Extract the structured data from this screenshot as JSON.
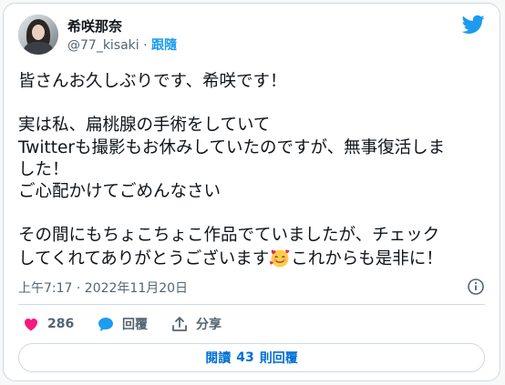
{
  "author": {
    "display_name": "希咲那奈",
    "handle": "@77_kisaki",
    "separator": "·",
    "follow_label": "跟隨"
  },
  "tweet": {
    "lines": [
      "皆さんお久しぶりです、希咲です！",
      "",
      "実は私、扁桃腺の手術をしていて",
      "Twitterも撮影もお休みしていたのですが、無事復活しま",
      "した！",
      "ご心配かけてごめんなさい",
      "",
      "その間にもちょこちょこ作品でていましたが、チェック"
    ],
    "last_line_before_emoji": "してくれてありがとうございます",
    "emoji": "smiling-face-with-hearts",
    "last_line_after_emoji": "これからも是非に！",
    "timestamp": "上午7:17 · 2022年11月20日"
  },
  "actions": {
    "like_count": "286",
    "reply_label": "回覆",
    "share_label": "分享"
  },
  "replies_button": {
    "prefix": "閱讀",
    "count": "43",
    "suffix": "則回覆"
  },
  "colors": {
    "accent": "#1d9bf0",
    "like": "#f91880",
    "link": "#006fd6"
  }
}
